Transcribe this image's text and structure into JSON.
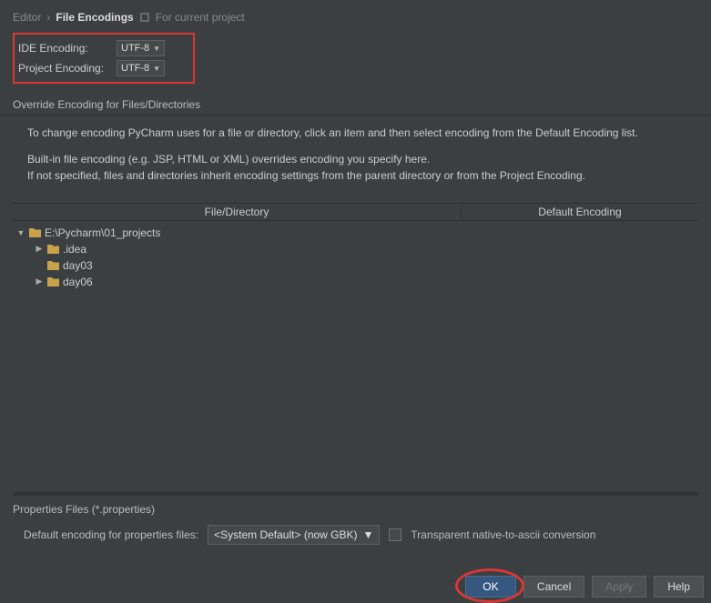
{
  "breadcrumb": {
    "parent": "Editor",
    "sep": "›",
    "current": "File Encodings",
    "scope": "For current project"
  },
  "encoding_controls": {
    "ide_label": "IDE Encoding:",
    "ide_value": "UTF-8",
    "project_label": "Project Encoding:",
    "project_value": "UTF-8"
  },
  "override": {
    "title": "Override Encoding for Files/Directories",
    "para1": "To change encoding PyCharm uses for a file or directory, click an item and then select encoding from the Default Encoding list.",
    "para2a": "Built-in file encoding (e.g. JSP, HTML or XML) overrides encoding you specify here.",
    "para2b": "If not specified, files and directories inherit encoding settings from the parent directory or from the Project Encoding."
  },
  "table": {
    "col_file": "File/Directory",
    "col_enc": "Default Encoding"
  },
  "tree": {
    "root": "E:\\Pycharm\\01_projects",
    "children": [
      {
        "label": ".idea",
        "expandable": true
      },
      {
        "label": "day03",
        "expandable": false
      },
      {
        "label": "day06",
        "expandable": true
      }
    ]
  },
  "properties": {
    "title": "Properties Files (*.properties)",
    "label": "Default encoding for properties files:",
    "value": "<System Default> (now GBK)",
    "checkbox_label": "Transparent native-to-ascii conversion"
  },
  "buttons": {
    "ok": "OK",
    "cancel": "Cancel",
    "apply": "Apply",
    "help": "Help"
  }
}
